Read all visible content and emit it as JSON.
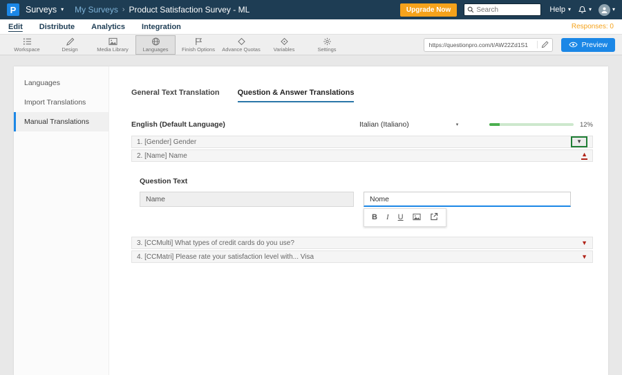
{
  "header": {
    "logo_letter": "P",
    "product_menu": "Surveys",
    "breadcrumb_parent": "My Surveys",
    "breadcrumb_separator": "›",
    "breadcrumb_title": "Product Satisfaction Survey - ML",
    "upgrade_label": "Upgrade Now",
    "search_placeholder": "Search",
    "help_label": "Help"
  },
  "nav": {
    "items": [
      {
        "label": "Edit",
        "active": true
      },
      {
        "label": "Distribute",
        "active": false
      },
      {
        "label": "Analytics",
        "active": false
      },
      {
        "label": "Integration",
        "active": false
      }
    ],
    "responses_label": "Responses: 0"
  },
  "toolbar": {
    "items": [
      {
        "label": "Workspace"
      },
      {
        "label": "Design"
      },
      {
        "label": "Media Library"
      },
      {
        "label": "Languages",
        "active": true
      },
      {
        "label": "Finish Options"
      },
      {
        "label": "Advance Quotas"
      },
      {
        "label": "Variables"
      },
      {
        "label": "Settings"
      }
    ],
    "survey_url": "https://questionpro.com/t/AW22Zd1S1",
    "preview_label": "Preview"
  },
  "sidebar": {
    "items": [
      {
        "label": "Languages",
        "active": false
      },
      {
        "label": "Import Translations",
        "active": false
      },
      {
        "label": "Manual Translations",
        "active": true
      }
    ]
  },
  "main": {
    "tabs": [
      {
        "label": "General Text Translation",
        "active": false
      },
      {
        "label": "Question & Answer Translations",
        "active": true
      }
    ],
    "source_language": "English (Default Language)",
    "target_language": "Italian (Italiano)",
    "progress_percent": "12%",
    "progress_value": 12,
    "questions": [
      {
        "label": "1. [Gender] Gender"
      },
      {
        "label": "2. [Name] Name"
      },
      {
        "label": "3. [CCMulti] What types of credit cards do you use?"
      },
      {
        "label": "4. [CCMatri] Please rate your satisfaction level with... Visa"
      }
    ],
    "editor": {
      "section_label": "Question Text",
      "source_value": "Name",
      "target_value": "Nome",
      "format_bold": "B",
      "format_italic": "I",
      "format_underline": "U"
    }
  },
  "colors": {
    "header_bg": "#1e3d54",
    "accent_blue": "#1b87e6",
    "accent_orange": "#f5a21b",
    "progress_green": "#4caf50",
    "caret_red": "#b02318",
    "focus_green": "#1e7e34"
  }
}
